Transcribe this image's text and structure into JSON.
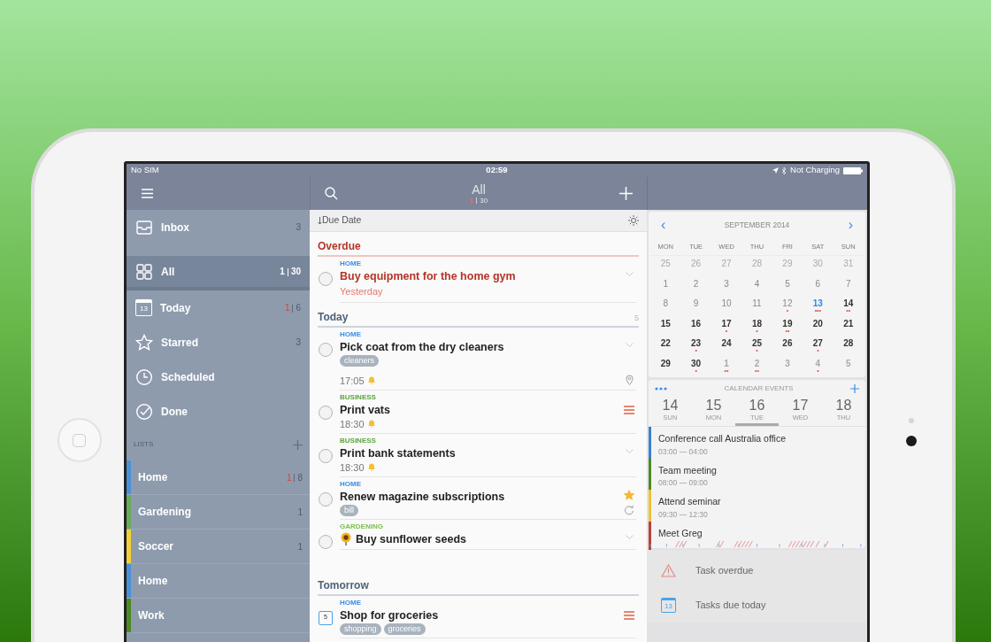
{
  "status_bar": {
    "carrier": "No SIM",
    "time": "02:59",
    "battery_text": "Not Charging"
  },
  "sidebar": {
    "items": [
      {
        "label": "Inbox",
        "count": "3",
        "selected": false
      },
      {
        "label": "All",
        "overdue": "1",
        "count": "30",
        "selected": true
      },
      {
        "label": "Today",
        "icon_day": "13",
        "overdue": "1",
        "count": "6",
        "selected": false
      },
      {
        "label": "Starred",
        "count": "3",
        "selected": false
      },
      {
        "label": "Scheduled",
        "selected": false
      },
      {
        "label": "Done",
        "selected": false
      }
    ],
    "lists_heading": "LISTS",
    "lists": [
      {
        "name": "Home",
        "color": "#4a90d9",
        "overdue": "1",
        "count": "8"
      },
      {
        "name": "Gardening",
        "color": "#6aac5a",
        "count": "1"
      },
      {
        "name": "Soccer",
        "color": "#f2d13a",
        "count": "1"
      },
      {
        "name": "Home",
        "color": "#4a90d9"
      },
      {
        "name": "Work",
        "color": "#4d8a25"
      }
    ]
  },
  "header": {
    "title": "All",
    "overdue": "1",
    "count": "30"
  },
  "sort": {
    "label": "Due Date"
  },
  "sections": [
    {
      "title": "Overdue",
      "kind": "overdue",
      "tasks": [
        {
          "list": "HOME",
          "color": "#3a8ee6",
          "title": "Buy equipment for the home gym",
          "overdue": true,
          "completed": false,
          "due": "Yesterday"
        }
      ]
    },
    {
      "title": "Today",
      "kind": "normal",
      "count": "5",
      "tasks": [
        {
          "list": "HOME",
          "color": "#3a8ee6",
          "title": "Pick coat from the dry cleaners",
          "overdue": false,
          "completed": false,
          "tags": [
            "cleaners"
          ],
          "time": "17:05",
          "alarm": true,
          "location": true
        },
        {
          "list": "BUSINESS",
          "color": "#5aa63a",
          "title": "Print vats",
          "overdue": false,
          "completed": false,
          "time": "18:30",
          "alarm": true,
          "priority": true
        },
        {
          "list": "BUSINESS",
          "color": "#5aa63a",
          "title": "Print bank statements",
          "overdue": false,
          "completed": false,
          "time": "18:30",
          "alarm": true
        },
        {
          "list": "HOME",
          "color": "#3a8ee6",
          "title": "Renew magazine subscriptions",
          "overdue": false,
          "completed": false,
          "tags": [
            "bill"
          ],
          "starred": true,
          "repeat": true
        },
        {
          "list": "GARDENING",
          "color": "#7cc04f",
          "title": "Buy sunflower seeds",
          "overdue": false,
          "completed": false,
          "flower": true
        }
      ]
    },
    {
      "title": "Tomorrow",
      "kind": "normal",
      "tasks": [
        {
          "list": "HOME",
          "color": "#3a8ee6",
          "title": "Shop for groceries",
          "overdue": false,
          "completed": false,
          "tags": [
            "shopping",
            "groceries"
          ],
          "calendar_day": "5",
          "priority": true
        }
      ]
    }
  ],
  "calendar": {
    "month": "SEPTEMBER 2014",
    "prev": "‹",
    "next": "›",
    "weekdays": [
      "MON",
      "TUE",
      "WED",
      "THU",
      "FRI",
      "SAT",
      "SUN"
    ],
    "days": [
      {
        "day": "25",
        "other_month": true,
        "past": true,
        "today": false
      },
      {
        "day": "26",
        "other_month": true,
        "past": true,
        "today": false
      },
      {
        "day": "27",
        "other_month": true,
        "past": true,
        "today": false
      },
      {
        "day": "28",
        "other_month": true,
        "past": true,
        "today": false
      },
      {
        "day": "29",
        "other_month": true,
        "past": true,
        "today": false
      },
      {
        "day": "30",
        "other_month": true,
        "past": true,
        "today": false
      },
      {
        "day": "31",
        "other_month": true,
        "past": true,
        "today": false
      },
      {
        "day": "1",
        "other_month": false,
        "past": true,
        "today": false
      },
      {
        "day": "2",
        "other_month": false,
        "past": true,
        "today": false
      },
      {
        "day": "3",
        "other_month": false,
        "past": true,
        "today": false
      },
      {
        "day": "4",
        "other_month": false,
        "past": true,
        "today": false
      },
      {
        "day": "5",
        "other_month": false,
        "past": true,
        "today": false
      },
      {
        "day": "6",
        "other_month": false,
        "past": true,
        "today": false
      },
      {
        "day": "7",
        "other_month": false,
        "past": true,
        "today": false
      },
      {
        "day": "8",
        "other_month": false,
        "past": true,
        "today": false
      },
      {
        "day": "9",
        "other_month": false,
        "past": true,
        "today": false
      },
      {
        "day": "10",
        "other_month": false,
        "past": true,
        "today": false
      },
      {
        "day": "11",
        "other_month": false,
        "past": true,
        "today": false
      },
      {
        "day": "12",
        "other_month": false,
        "past": true,
        "today": false,
        "dots": "•"
      },
      {
        "day": "13",
        "other_month": false,
        "past": false,
        "today": true,
        "dots": "•••"
      },
      {
        "day": "14",
        "other_month": false,
        "past": false,
        "today": false,
        "dots": "••"
      },
      {
        "day": "15",
        "other_month": false,
        "past": false,
        "today": false
      },
      {
        "day": "16",
        "other_month": false,
        "past": false,
        "today": false
      },
      {
        "day": "17",
        "other_month": false,
        "past": false,
        "today": false,
        "dots": "•"
      },
      {
        "day": "18",
        "other_month": false,
        "past": false,
        "today": false,
        "dots": "•"
      },
      {
        "day": "19",
        "other_month": false,
        "past": false,
        "today": false,
        "dots": "••"
      },
      {
        "day": "20",
        "other_month": false,
        "past": false,
        "today": false
      },
      {
        "day": "21",
        "other_month": false,
        "past": false,
        "today": false
      },
      {
        "day": "22",
        "other_month": false,
        "past": false,
        "today": false
      },
      {
        "day": "23",
        "other_month": false,
        "past": false,
        "today": false,
        "dots": "•"
      },
      {
        "day": "24",
        "other_month": false,
        "past": false,
        "today": false
      },
      {
        "day": "25",
        "other_month": false,
        "past": false,
        "today": false,
        "dots": "•"
      },
      {
        "day": "26",
        "other_month": false,
        "past": false,
        "today": false
      },
      {
        "day": "27",
        "other_month": false,
        "past": false,
        "today": false,
        "dots": "•"
      },
      {
        "day": "28",
        "other_month": false,
        "past": false,
        "today": false
      },
      {
        "day": "29",
        "other_month": false,
        "past": false,
        "today": false
      },
      {
        "day": "30",
        "other_month": false,
        "past": false,
        "today": false,
        "dots": "•"
      },
      {
        "day": "1",
        "other_month": true,
        "past": false,
        "today": false,
        "dots": "••"
      },
      {
        "day": "2",
        "other_month": true,
        "past": false,
        "today": false,
        "dots": "••"
      },
      {
        "day": "3",
        "other_month": true,
        "past": false,
        "today": false
      },
      {
        "day": "4",
        "other_month": true,
        "past": false,
        "today": false,
        "dots": "•"
      },
      {
        "day": "5",
        "other_month": true,
        "past": false,
        "today": false
      }
    ]
  },
  "events_panel": {
    "title": "CALENDAR EVENTS",
    "days": [
      {
        "date": "14",
        "weekday": "SUN",
        "selected": false
      },
      {
        "date": "15",
        "weekday": "MON",
        "selected": false
      },
      {
        "date": "16",
        "weekday": "TUE",
        "selected": true
      },
      {
        "date": "17",
        "weekday": "WED",
        "selected": false
      },
      {
        "date": "18",
        "weekday": "THU",
        "selected": false
      }
    ],
    "events": [
      {
        "title": "Conference call Australia office",
        "time": "03:00 — 04:00",
        "color": "#3a7fd0"
      },
      {
        "title": "Team meeting",
        "time": "08:00 — 09:00",
        "color": "#4d8a25"
      },
      {
        "title": "Attend seminar",
        "time": "09:30 — 12:30",
        "color": "#f2c12e"
      },
      {
        "title": "Meet Greg",
        "color": "#b8423a"
      }
    ]
  },
  "alerts": [
    {
      "kind": "overdue",
      "label": "Task overdue"
    },
    {
      "kind": "today",
      "icon_day": "13",
      "label": "Tasks due today"
    }
  ]
}
